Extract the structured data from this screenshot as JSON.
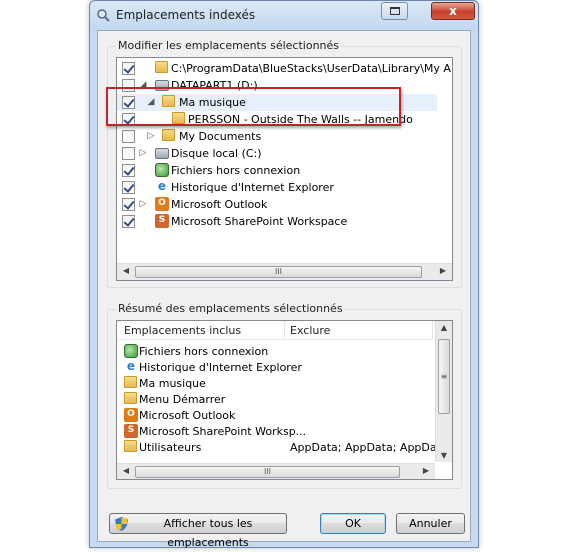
{
  "window": {
    "title": "Emplacements indexés",
    "close_glyph": "x"
  },
  "selected_group": {
    "legend": "Modifier les emplacements sélectionnés",
    "items": [
      {
        "label": "C:\\ProgramData\\BlueStacks\\UserData\\Library\\My Apps\\ (Non",
        "checked": true,
        "icon": "folder-icon"
      },
      {
        "label": "DATAPART1 (D:)",
        "checked": false,
        "icon": "drive-icon",
        "expander": "◢"
      },
      {
        "label": "Ma musique",
        "checked": true,
        "icon": "folder-icon",
        "expander": "◢"
      },
      {
        "label": "PERSSON - Outside The Walls -- Jamendo",
        "checked": true,
        "icon": "folder-icon"
      },
      {
        "label": "My Documents",
        "checked": false,
        "icon": "folder-icon",
        "expander": "▷"
      },
      {
        "label": "Disque local (C:)",
        "checked": false,
        "icon": "drive-icon",
        "expander": "▷"
      },
      {
        "label": "Fichiers hors connexion",
        "checked": true,
        "icon": "offline-files-icon"
      },
      {
        "label": "Historique d'Internet Explorer",
        "checked": true,
        "icon": "internet-explorer-icon"
      },
      {
        "label": "Microsoft Outlook",
        "checked": true,
        "icon": "outlook-icon",
        "expander": "▷"
      },
      {
        "label": "Microsoft SharePoint Workspace",
        "checked": true,
        "icon": "sharepoint-icon"
      }
    ],
    "scroll_thumb": "III"
  },
  "summary_group": {
    "legend": "Résumé des emplacements sélectionnés",
    "columns": {
      "included": "Emplacements inclus",
      "excluded": "Exclure"
    },
    "rows": [
      {
        "label": "Fichiers hors connexion",
        "exclude": "",
        "icon": "offline-files-icon"
      },
      {
        "label": "Historique d'Internet Explorer",
        "exclude": "",
        "icon": "internet-explorer-icon"
      },
      {
        "label": "Ma musique",
        "exclude": "",
        "icon": "folder-icon"
      },
      {
        "label": "Menu Démarrer",
        "exclude": "",
        "icon": "folder-icon"
      },
      {
        "label": "Microsoft Outlook",
        "exclude": "",
        "icon": "outlook-icon"
      },
      {
        "label": "Microsoft SharePoint Worksp...",
        "exclude": "",
        "icon": "sharepoint-icon"
      },
      {
        "label": "Utilisateurs",
        "exclude": "AppData; AppData; AppData; ...",
        "icon": "folder-icon"
      }
    ],
    "scroll_thumb": "III",
    "vscroll_thumb": "≡"
  },
  "buttons": {
    "show_all": "Afficher tous les emplacements",
    "ok": "OK",
    "cancel": "Annuler"
  },
  "colors": {
    "highlight": "#c0272d",
    "outlook": "#e07b1a",
    "sharepoint": "#d4662b",
    "ie": "#2a7fd4",
    "offline": "#3a9a3a"
  }
}
